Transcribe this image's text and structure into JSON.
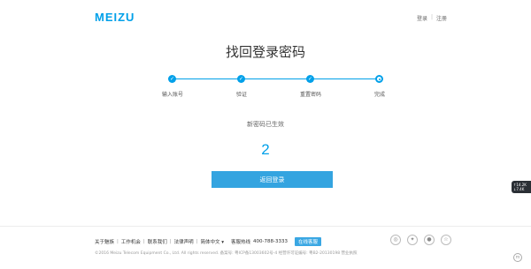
{
  "header": {
    "logo": "MEIZU",
    "login": "登录",
    "separator": "|",
    "register": "注册"
  },
  "page": {
    "title": "找回登录密码"
  },
  "steps": [
    {
      "label": "输入账号",
      "state": "done"
    },
    {
      "label": "验证",
      "state": "done"
    },
    {
      "label": "重置密码",
      "state": "done"
    },
    {
      "label": "完成",
      "state": "current"
    }
  ],
  "result": {
    "message": "新密码已生效",
    "countdown": "2",
    "button": "返回登录"
  },
  "side_widget": {
    "line1": "↑14.2K",
    "line2": "↓7.4K"
  },
  "footer": {
    "links": [
      "关于魅族",
      "工作机会",
      "联系我们",
      "法律声明",
      "简体中文"
    ],
    "language_suffix": "▾",
    "hotline_label": "客服热线",
    "hotline_number": "400-788-3333",
    "support": "在线客服",
    "copyright": "©2016 Meizu Telecom Equipment Co., Ltd. All rights reserved. 备案号: 粤ICP备13003602号-4 经营许可证编号: 粤B2-20130198 营业执照"
  },
  "social_icons": [
    "weibo-icon",
    "qzone-icon",
    "wechat-icon",
    "star-icon"
  ],
  "colors": {
    "accent": "#00a0e9",
    "button": "#34a4e0"
  }
}
